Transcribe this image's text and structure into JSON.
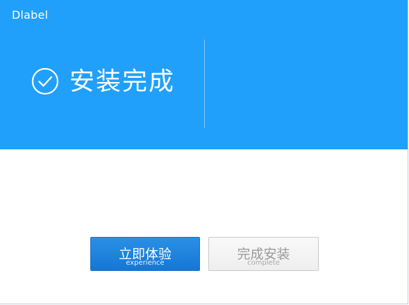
{
  "window": {
    "title": "Dlabel"
  },
  "status": {
    "title": "安装完成",
    "icon": "check-circle-icon"
  },
  "buttons": {
    "experience": {
      "label": "立即体验",
      "sublabel": "experience"
    },
    "complete": {
      "label": "完成安装",
      "sublabel": "complete"
    }
  },
  "colors": {
    "banner": "#20a0fb",
    "primary_button": "#1577d4",
    "secondary_button": "#eeeeee"
  }
}
